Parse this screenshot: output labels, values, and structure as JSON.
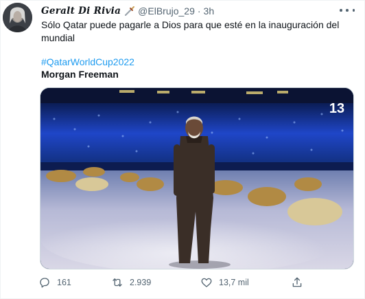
{
  "tweet": {
    "author_name": "Geralt Di Rivia",
    "handle": "@ElBrujo_29",
    "separator": "·",
    "time": "3h",
    "text": "Sólo Qatar puede pagarle a Dios para que esté en la inauguración del mundial",
    "hashtag": "#QatarWorldCup2022",
    "subject_name": "Morgan Freeman",
    "media_channel_logo": "13",
    "icons": {
      "avatar": "avatar-image",
      "badge": "sword-icon",
      "more": "more-options-icon",
      "reply": "reply-icon",
      "retweet": "retweet-icon",
      "like": "like-icon",
      "share": "share-icon"
    }
  },
  "actions": {
    "replies": "161",
    "retweets": "2.939",
    "likes": "13,7 mil"
  },
  "colors": {
    "link": "#1d9bf0",
    "secondary_text": "#536471",
    "primary_text": "#0f1419"
  }
}
